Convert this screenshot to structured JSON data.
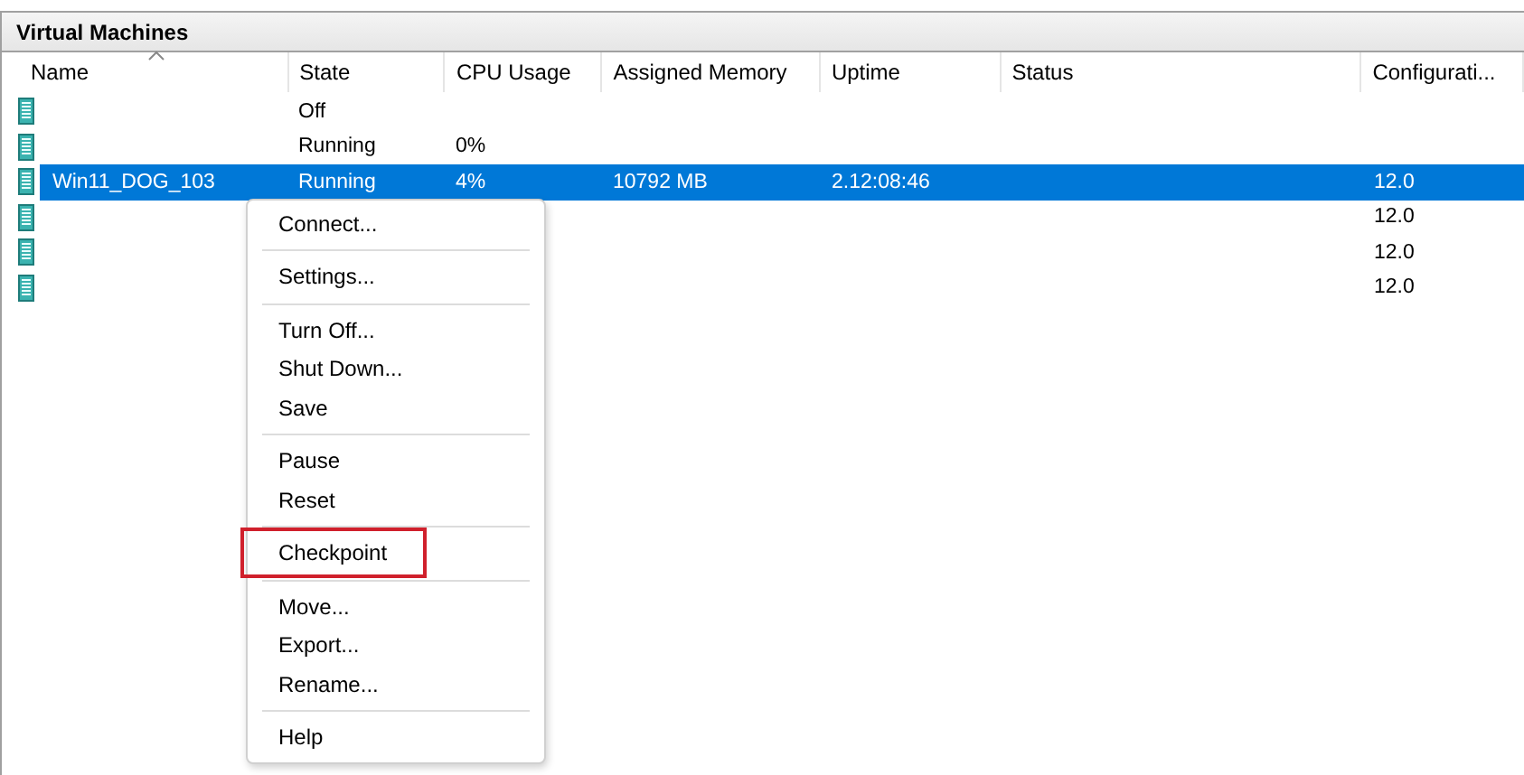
{
  "panel": {
    "title": "Virtual Machines"
  },
  "table": {
    "columns": [
      {
        "label": "Name",
        "sorted": true
      },
      {
        "label": "State",
        "sorted": false
      },
      {
        "label": "CPU Usage",
        "sorted": false
      },
      {
        "label": "Assigned Memory",
        "sorted": false
      },
      {
        "label": "Uptime",
        "sorted": false
      },
      {
        "label": "Status",
        "sorted": false
      },
      {
        "label": "Configurati...",
        "sorted": false
      }
    ],
    "rows": [
      {
        "selected": false,
        "cells": {
          "state": "Off"
        }
      },
      {
        "selected": false,
        "cells": {
          "state": "Running",
          "cpu": "0%"
        }
      },
      {
        "selected": true,
        "cells": {
          "name": "Win11_DOG_103",
          "state": "Running",
          "cpu": "4%",
          "memory": "10792 MB",
          "uptime": "2.12:08:46",
          "config": "12.0"
        }
      },
      {
        "selected": false,
        "cells": {
          "config": "12.0"
        }
      },
      {
        "selected": false,
        "cells": {
          "config": "12.0"
        }
      },
      {
        "selected": false,
        "cells": {
          "config": "12.0"
        }
      }
    ]
  },
  "context_menu": {
    "groups": [
      [
        {
          "label": "Connect...",
          "highlighted": false
        }
      ],
      [
        {
          "label": "Settings...",
          "highlighted": false
        }
      ],
      [
        {
          "label": "Turn Off...",
          "highlighted": false
        },
        {
          "label": "Shut Down...",
          "highlighted": false
        },
        {
          "label": "Save",
          "highlighted": false
        }
      ],
      [
        {
          "label": "Pause",
          "highlighted": false
        },
        {
          "label": "Reset",
          "highlighted": false
        }
      ],
      [
        {
          "label": "Checkpoint",
          "highlighted": true
        }
      ],
      [
        {
          "label": "Move...",
          "highlighted": false
        },
        {
          "label": "Export...",
          "highlighted": false
        },
        {
          "label": "Rename...",
          "highlighted": false
        }
      ],
      [
        {
          "label": "Help",
          "highlighted": false
        }
      ]
    ]
  }
}
